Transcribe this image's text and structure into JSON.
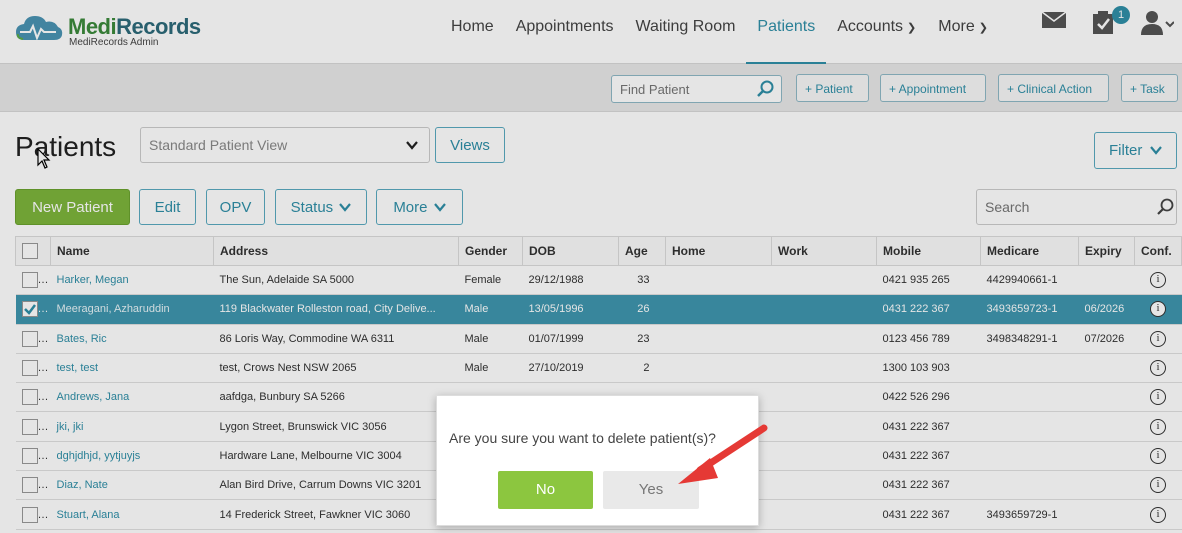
{
  "app": {
    "logo_brand": "MediRecords",
    "logo_sub": "MediRecords Admin"
  },
  "nav": {
    "items": [
      {
        "label": "Home",
        "active": false,
        "caret": false
      },
      {
        "label": "Appointments",
        "active": false,
        "caret": false
      },
      {
        "label": "Waiting Room",
        "active": false,
        "caret": false
      },
      {
        "label": "Patients",
        "active": true,
        "caret": true
      },
      {
        "label": "Accounts",
        "active": false,
        "caret": true
      },
      {
        "label": "More",
        "active": false,
        "caret": true
      }
    ],
    "tasks_badge": "1",
    "icons": [
      "mail-icon",
      "tasks-icon",
      "user-icon"
    ]
  },
  "toolbar": {
    "find_placeholder": "Find Patient",
    "add_patient": "+ Patient",
    "add_appointment": "+ Appointment",
    "add_clinical_action": "+ Clinical Action",
    "add_task": "+ Task"
  },
  "page": {
    "title": "Patients",
    "view_select": "Standard Patient View",
    "views_button": "Views",
    "filter_button": "Filter",
    "new_patient": "New Patient",
    "edit": "Edit",
    "opv": "OPV",
    "status": "Status",
    "more": "More",
    "search_placeholder": "Search"
  },
  "table": {
    "columns": [
      "",
      "Name",
      "Address",
      "Gender",
      "DOB",
      "Age",
      "Home",
      "Work",
      "Mobile",
      "Medicare",
      "Expiry",
      "Conf."
    ],
    "rows": [
      {
        "name": "Harker, Megan",
        "address": "The Sun, Adelaide SA 5000",
        "gender": "Female",
        "dob": "29/12/1988",
        "age": "33",
        "home": "",
        "work": "",
        "mobile": "0421 935 265",
        "medicare": "4429940661-1",
        "expiry": "",
        "selected": false
      },
      {
        "name": "Meeragani, Azharuddin",
        "address": "119 Blackwater Rolleston road, City Delive...",
        "gender": "Male",
        "dob": "13/05/1996",
        "age": "26",
        "home": "",
        "work": "",
        "mobile": "0431 222 367",
        "medicare": "3493659723-1",
        "expiry": "06/2026",
        "selected": true
      },
      {
        "name": "Bates, Ric",
        "address": "86 Loris Way, Commodine WA 6311",
        "gender": "Male",
        "dob": "01/07/1999",
        "age": "23",
        "home": "",
        "work": "",
        "mobile": "0123 456 789",
        "medicare": "3498348291-1",
        "expiry": "07/2026",
        "selected": false
      },
      {
        "name": "test, test",
        "address": "test, Crows Nest NSW 2065",
        "gender": "Male",
        "dob": "27/10/2019",
        "age": "2",
        "home": "",
        "work": "",
        "mobile": "1300 103 903",
        "medicare": "",
        "expiry": "",
        "selected": false
      },
      {
        "name": "Andrews, Jana",
        "address": "aafdga, Bunbury SA 5266",
        "gender": "",
        "dob": "",
        "age": "",
        "home": "",
        "work": "",
        "mobile": "0422 526 296",
        "medicare": "",
        "expiry": "",
        "selected": false
      },
      {
        "name": "jki, jki",
        "address": "Lygon Street, Brunswick VIC 3056",
        "gender": "",
        "dob": "",
        "age": "",
        "home": "",
        "work": "",
        "mobile": "0431 222 367",
        "medicare": "",
        "expiry": "",
        "selected": false
      },
      {
        "name": "dghjdhjd, yytjuyjs",
        "address": "Hardware Lane, Melbourne VIC 3004",
        "gender": "",
        "dob": "",
        "age": "",
        "home": "",
        "work": "",
        "mobile": "0431 222 367",
        "medicare": "",
        "expiry": "",
        "selected": false
      },
      {
        "name": "Diaz, Nate",
        "address": "Alan Bird Drive, Carrum Downs VIC 3201",
        "gender": "",
        "dob": "",
        "age": "",
        "home": "",
        "work": "",
        "mobile": "0431 222 367",
        "medicare": "",
        "expiry": "",
        "selected": false
      },
      {
        "name": "Stuart, Alana",
        "address": "14 Frederick Street, Fawkner VIC 3060",
        "gender": "",
        "dob": "",
        "age": "",
        "home": "",
        "work": "",
        "mobile": "0431 222 367",
        "medicare": "3493659729-1",
        "expiry": "",
        "selected": false
      }
    ]
  },
  "modal": {
    "message": "Are you sure you want to delete patient(s)?",
    "no_label": "No",
    "yes_label": "Yes"
  },
  "colors": {
    "brand": "#2f8fa8",
    "primary_green": "#7db53c",
    "modal_no": "#8cc63f",
    "selected_row": "#3f96ae",
    "arrow": "#e53935"
  }
}
